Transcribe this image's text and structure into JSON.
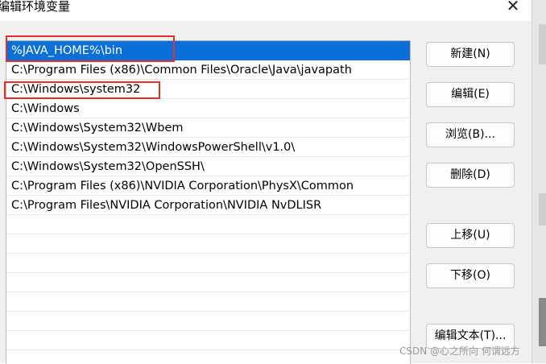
{
  "window": {
    "title": "编辑环境变量",
    "close_glyph": "✕"
  },
  "path_list": {
    "entries": [
      "%JAVA_HOME%\\bin",
      "C:\\Program Files (x86)\\Common Files\\Oracle\\Java\\javapath",
      "C:\\Windows\\system32",
      "C:\\Windows",
      "C:\\Windows\\System32\\Wbem",
      "C:\\Windows\\System32\\WindowsPowerShell\\v1.0\\",
      "C:\\Windows\\System32\\OpenSSH\\",
      "C:\\Program Files (x86)\\NVIDIA Corporation\\PhysX\\Common",
      "C:\\Program Files\\NVIDIA Corporation\\NVIDIA NvDLISR"
    ],
    "selected_index": 0,
    "selected_color": "#0a6fd6",
    "annotation_color": "#e03030"
  },
  "buttons": {
    "new": "新建(N)",
    "edit": "编辑(E)",
    "browse": "浏览(B)...",
    "delete": "删除(D)",
    "move_up": "上移(U)",
    "move_down": "下移(O)",
    "edit_text": "编辑文本(T)..."
  },
  "watermark": "CSDN @心之所向 何谓远方"
}
